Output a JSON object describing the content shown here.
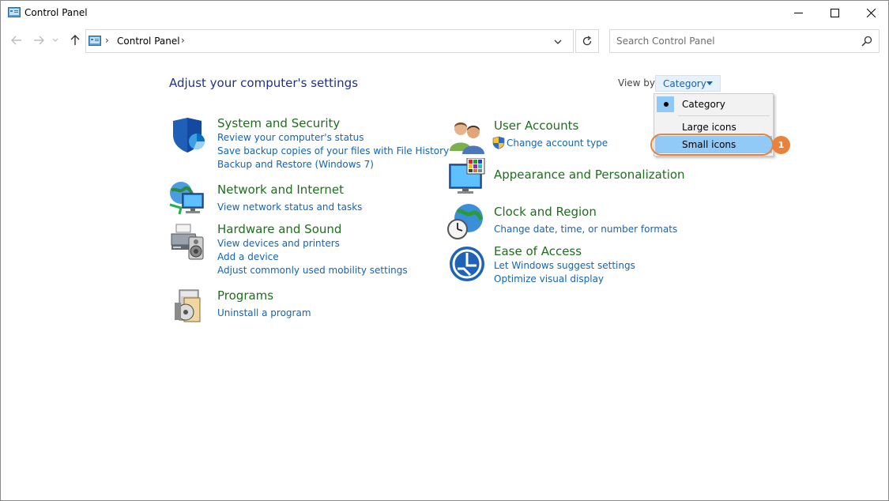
{
  "window": {
    "title": "Control Panel"
  },
  "nav": {
    "breadcrumb": "Control Panel",
    "search_placeholder": "Search Control Panel"
  },
  "content": {
    "page_title": "Adjust your computer's settings",
    "view_by_label": "View by:",
    "view_by_value": "Category"
  },
  "view_menu": {
    "items": [
      "Category",
      "Large icons",
      "Small icons"
    ],
    "selected": "Category",
    "hovered": "Small icons",
    "step_badge": "1"
  },
  "categories": {
    "system_security": {
      "title": "System and Security",
      "links": [
        "Review your computer's status",
        "Save backup copies of your files with File History",
        "Backup and Restore (Windows 7)"
      ]
    },
    "network_internet": {
      "title": "Network and Internet",
      "links": [
        "View network status and tasks"
      ]
    },
    "hardware_sound": {
      "title": "Hardware and Sound",
      "links": [
        "View devices and printers",
        "Add a device",
        "Adjust commonly used mobility settings"
      ]
    },
    "programs": {
      "title": "Programs",
      "links": [
        "Uninstall a program"
      ]
    },
    "user_accounts": {
      "title": "User Accounts",
      "links": [
        "Change account type"
      ]
    },
    "appearance": {
      "title": "Appearance and Personalization",
      "links": []
    },
    "clock_region": {
      "title": "Clock and Region",
      "links": [
        "Change date, time, or number formats"
      ]
    },
    "ease_access": {
      "title": "Ease of Access",
      "links": [
        "Let Windows suggest settings",
        "Optimize visual display"
      ]
    }
  },
  "colors": {
    "category_title": "#1e6e1e",
    "link": "#1464b4",
    "page_title": "#1e3287",
    "highlight": "#e8823c",
    "menu_hover": "#91c9f7"
  }
}
